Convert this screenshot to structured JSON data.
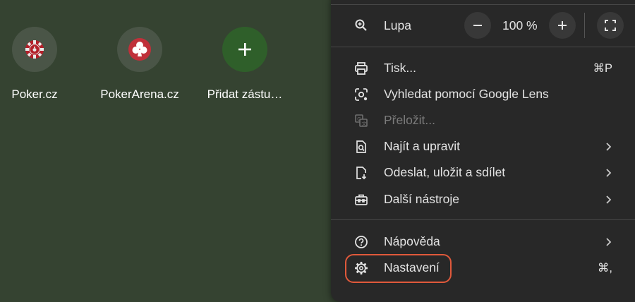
{
  "shortcuts": [
    {
      "label": "Poker.cz",
      "icon": "poker-chip-icon"
    },
    {
      "label": "PokerArena.cz",
      "icon": "club-suit-icon"
    },
    {
      "label": "Přidat zástu…",
      "icon": "plus-icon"
    }
  ],
  "menu": {
    "zoom": {
      "label": "Lupa",
      "value": "100 %",
      "minus": "−",
      "plus": "+"
    },
    "items": [
      {
        "label": "Tisk...",
        "shortcut": "⌘P",
        "icon": "print-icon"
      },
      {
        "label": "Vyhledat pomocí Google Lens",
        "icon": "google-lens-icon"
      },
      {
        "label": "Přeložit...",
        "icon": "translate-icon",
        "disabled": true
      },
      {
        "label": "Najít a upravit",
        "icon": "find-edit-icon",
        "submenu": true
      },
      {
        "label": "Odeslat, uložit a sdílet",
        "icon": "share-save-icon",
        "submenu": true
      },
      {
        "label": "Další nástroje",
        "icon": "toolbox-icon",
        "submenu": true
      },
      {
        "label": "Nápověda",
        "icon": "help-icon",
        "submenu": true
      },
      {
        "label": "Nastavení",
        "shortcut": "⌘,",
        "icon": "gear-icon"
      }
    ]
  },
  "colors": {
    "background": "#354331",
    "menu": "#282828",
    "highlight": "#e0593b",
    "add_tile": "#2f5f2a"
  }
}
